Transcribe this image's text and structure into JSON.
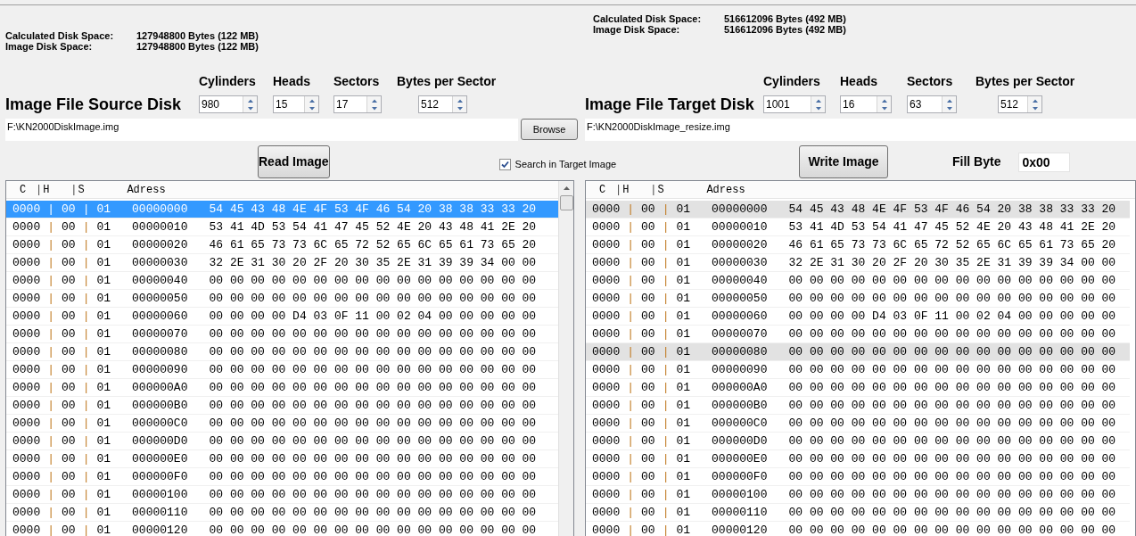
{
  "panels": [
    {
      "kind": "source",
      "disk_space": [
        {
          "label": "Calculated Disk Space:",
          "value": "127948800 Bytes (122 MB)"
        },
        {
          "label": "Image Disk Space:",
          "value": "127948800 Bytes (122 MB)"
        }
      ],
      "heading": "Image File Source Disk",
      "geometry": [
        {
          "label": "Cylinders",
          "value": "980"
        },
        {
          "label": "Heads",
          "value": "15"
        },
        {
          "label": "Sectors",
          "value": "17"
        },
        {
          "label": "Bytes per Sector",
          "value": "512"
        }
      ],
      "path": "F:\\KN2000DiskImage.img",
      "browse_button": "Browse",
      "action_button": "Read Image",
      "list": {
        "separator": "|",
        "header": [
          "C",
          "H",
          "S",
          "Adress"
        ],
        "rows": [
          {
            "c": "0000",
            "h": "00",
            "s": "01",
            "address": "00000000",
            "bytes": "54 45 43 48 4E 4F 53 4F 46 54 20 38 38 33 33 20",
            "selected": true
          },
          {
            "c": "0000",
            "h": "00",
            "s": "01",
            "address": "00000010",
            "bytes": "53 41 4D 53 54 41 47 45 52 4E 20 43 48 41 2E 20",
            "selected": false
          },
          {
            "c": "0000",
            "h": "00",
            "s": "01",
            "address": "00000020",
            "bytes": "46 61 65 73 73 6C 65 72 52 65 6C 65 61 73 65 20",
            "selected": false
          },
          {
            "c": "0000",
            "h": "00",
            "s": "01",
            "address": "00000030",
            "bytes": "32 2E 31 30 20 2F 20 30 35 2E 31 39 39 34 00 00",
            "selected": false
          },
          {
            "c": "0000",
            "h": "00",
            "s": "01",
            "address": "00000040",
            "bytes": "00 00 00 00 00 00 00 00 00 00 00 00 00 00 00 00",
            "selected": false
          },
          {
            "c": "0000",
            "h": "00",
            "s": "01",
            "address": "00000050",
            "bytes": "00 00 00 00 00 00 00 00 00 00 00 00 00 00 00 00",
            "selected": false
          },
          {
            "c": "0000",
            "h": "00",
            "s": "01",
            "address": "00000060",
            "bytes": "00 00 00 00 D4 03 0F 11 00 02 04 00 00 00 00 00",
            "selected": false
          },
          {
            "c": "0000",
            "h": "00",
            "s": "01",
            "address": "00000070",
            "bytes": "00 00 00 00 00 00 00 00 00 00 00 00 00 00 00 00",
            "selected": false
          },
          {
            "c": "0000",
            "h": "00",
            "s": "01",
            "address": "00000080",
            "bytes": "00 00 00 00 00 00 00 00 00 00 00 00 00 00 00 00",
            "selected": false
          },
          {
            "c": "0000",
            "h": "00",
            "s": "01",
            "address": "00000090",
            "bytes": "00 00 00 00 00 00 00 00 00 00 00 00 00 00 00 00",
            "selected": false
          },
          {
            "c": "0000",
            "h": "00",
            "s": "01",
            "address": "000000A0",
            "bytes": "00 00 00 00 00 00 00 00 00 00 00 00 00 00 00 00",
            "selected": false
          },
          {
            "c": "0000",
            "h": "00",
            "s": "01",
            "address": "000000B0",
            "bytes": "00 00 00 00 00 00 00 00 00 00 00 00 00 00 00 00",
            "selected": false
          },
          {
            "c": "0000",
            "h": "00",
            "s": "01",
            "address": "000000C0",
            "bytes": "00 00 00 00 00 00 00 00 00 00 00 00 00 00 00 00",
            "selected": false
          },
          {
            "c": "0000",
            "h": "00",
            "s": "01",
            "address": "000000D0",
            "bytes": "00 00 00 00 00 00 00 00 00 00 00 00 00 00 00 00",
            "selected": false
          },
          {
            "c": "0000",
            "h": "00",
            "s": "01",
            "address": "000000E0",
            "bytes": "00 00 00 00 00 00 00 00 00 00 00 00 00 00 00 00",
            "selected": false
          },
          {
            "c": "0000",
            "h": "00",
            "s": "01",
            "address": "000000F0",
            "bytes": "00 00 00 00 00 00 00 00 00 00 00 00 00 00 00 00",
            "selected": false
          },
          {
            "c": "0000",
            "h": "00",
            "s": "01",
            "address": "00000100",
            "bytes": "00 00 00 00 00 00 00 00 00 00 00 00 00 00 00 00",
            "selected": false
          },
          {
            "c": "0000",
            "h": "00",
            "s": "01",
            "address": "00000110",
            "bytes": "00 00 00 00 00 00 00 00 00 00 00 00 00 00 00 00",
            "selected": false
          },
          {
            "c": "0000",
            "h": "00",
            "s": "01",
            "address": "00000120",
            "bytes": "00 00 00 00 00 00 00 00 00 00 00 00 00 00 00 00",
            "selected": false
          }
        ]
      }
    },
    {
      "kind": "target",
      "disk_space": [
        {
          "label": "Calculated Disk Space:",
          "value": "516612096 Bytes (492 MB)"
        },
        {
          "label": "Image Disk Space:",
          "value": "516612096 Bytes (492 MB)"
        }
      ],
      "heading": "Image File Target Disk",
      "geometry": [
        {
          "label": "Cylinders",
          "value": "1001"
        },
        {
          "label": "Heads",
          "value": "16"
        },
        {
          "label": "Sectors",
          "value": "63"
        },
        {
          "label": "Bytes per Sector",
          "value": "512"
        }
      ],
      "path": "F:\\KN2000DiskImage_resize.img",
      "action_button": "Write Image",
      "fill_byte": {
        "label": "Fill Byte",
        "value": "0x00"
      },
      "list": {
        "separator": "|",
        "header": [
          "C",
          "H",
          "S",
          "Adress"
        ],
        "rows": [
          {
            "c": "0000",
            "h": "00",
            "s": "01",
            "address": "00000000",
            "bytes": "54 45 43 48 4E 4F 53 4F 46 54 20 38 38 33 33 20",
            "selected": true
          },
          {
            "c": "0000",
            "h": "00",
            "s": "01",
            "address": "00000010",
            "bytes": "53 41 4D 53 54 41 47 45 52 4E 20 43 48 41 2E 20",
            "selected": false
          },
          {
            "c": "0000",
            "h": "00",
            "s": "01",
            "address": "00000020",
            "bytes": "46 61 65 73 73 6C 65 72 52 65 6C 65 61 73 65 20",
            "selected": false
          },
          {
            "c": "0000",
            "h": "00",
            "s": "01",
            "address": "00000030",
            "bytes": "32 2E 31 30 20 2F 20 30 35 2E 31 39 39 34 00 00",
            "selected": false
          },
          {
            "c": "0000",
            "h": "00",
            "s": "01",
            "address": "00000040",
            "bytes": "00 00 00 00 00 00 00 00 00 00 00 00 00 00 00 00",
            "selected": false
          },
          {
            "c": "0000",
            "h": "00",
            "s": "01",
            "address": "00000050",
            "bytes": "00 00 00 00 00 00 00 00 00 00 00 00 00 00 00 00",
            "selected": false
          },
          {
            "c": "0000",
            "h": "00",
            "s": "01",
            "address": "00000060",
            "bytes": "00 00 00 00 D4 03 0F 11 00 02 04 00 00 00 00 00",
            "selected": false
          },
          {
            "c": "0000",
            "h": "00",
            "s": "01",
            "address": "00000070",
            "bytes": "00 00 00 00 00 00 00 00 00 00 00 00 00 00 00 00",
            "selected": false
          },
          {
            "c": "0000",
            "h": "00",
            "s": "01",
            "address": "00000080",
            "bytes": "00 00 00 00 00 00 00 00 00 00 00 00 00 00 00 00",
            "selected": true
          },
          {
            "c": "0000",
            "h": "00",
            "s": "01",
            "address": "00000090",
            "bytes": "00 00 00 00 00 00 00 00 00 00 00 00 00 00 00 00",
            "selected": false
          },
          {
            "c": "0000",
            "h": "00",
            "s": "01",
            "address": "000000A0",
            "bytes": "00 00 00 00 00 00 00 00 00 00 00 00 00 00 00 00",
            "selected": false
          },
          {
            "c": "0000",
            "h": "00",
            "s": "01",
            "address": "000000B0",
            "bytes": "00 00 00 00 00 00 00 00 00 00 00 00 00 00 00 00",
            "selected": false
          },
          {
            "c": "0000",
            "h": "00",
            "s": "01",
            "address": "000000C0",
            "bytes": "00 00 00 00 00 00 00 00 00 00 00 00 00 00 00 00",
            "selected": false
          },
          {
            "c": "0000",
            "h": "00",
            "s": "01",
            "address": "000000D0",
            "bytes": "00 00 00 00 00 00 00 00 00 00 00 00 00 00 00 00",
            "selected": false
          },
          {
            "c": "0000",
            "h": "00",
            "s": "01",
            "address": "000000E0",
            "bytes": "00 00 00 00 00 00 00 00 00 00 00 00 00 00 00 00",
            "selected": false
          },
          {
            "c": "0000",
            "h": "00",
            "s": "01",
            "address": "000000F0",
            "bytes": "00 00 00 00 00 00 00 00 00 00 00 00 00 00 00 00",
            "selected": false
          },
          {
            "c": "0000",
            "h": "00",
            "s": "01",
            "address": "00000100",
            "bytes": "00 00 00 00 00 00 00 00 00 00 00 00 00 00 00 00",
            "selected": false
          },
          {
            "c": "0000",
            "h": "00",
            "s": "01",
            "address": "00000110",
            "bytes": "00 00 00 00 00 00 00 00 00 00 00 00 00 00 00 00",
            "selected": false
          },
          {
            "c": "0000",
            "h": "00",
            "s": "01",
            "address": "00000120",
            "bytes": "00 00 00 00 00 00 00 00 00 00 00 00 00 00 00 00",
            "selected": false
          }
        ]
      }
    }
  ],
  "search_in_target": {
    "label": "Search in Target Image",
    "checked": true
  }
}
